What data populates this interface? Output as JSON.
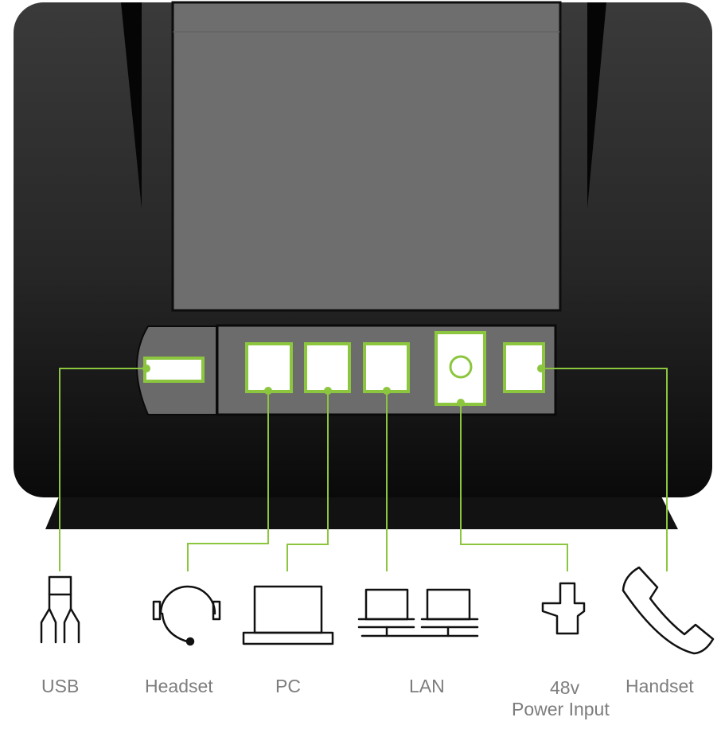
{
  "colors": {
    "accent": "#8cc63f",
    "device_dark": "#0d0d0d",
    "screen": "#6e6e6e",
    "port_panel": "#6c6c6c",
    "icon_stroke": "#111111",
    "label_text": "#7d7d7d"
  },
  "ports": [
    {
      "id": "usb",
      "label": "USB",
      "icon": "usb-connector-icon"
    },
    {
      "id": "headset",
      "label": "Headset",
      "icon": "headset-icon"
    },
    {
      "id": "pc",
      "label": "PC",
      "icon": "laptop-icon"
    },
    {
      "id": "lan",
      "label": "LAN",
      "icon": "network-computers-icon"
    },
    {
      "id": "power",
      "label_line1": "48v",
      "label_line2": "Power Input",
      "icon": "power-plug-icon"
    },
    {
      "id": "handset",
      "label": "Handset",
      "icon": "phone-handset-icon"
    }
  ]
}
